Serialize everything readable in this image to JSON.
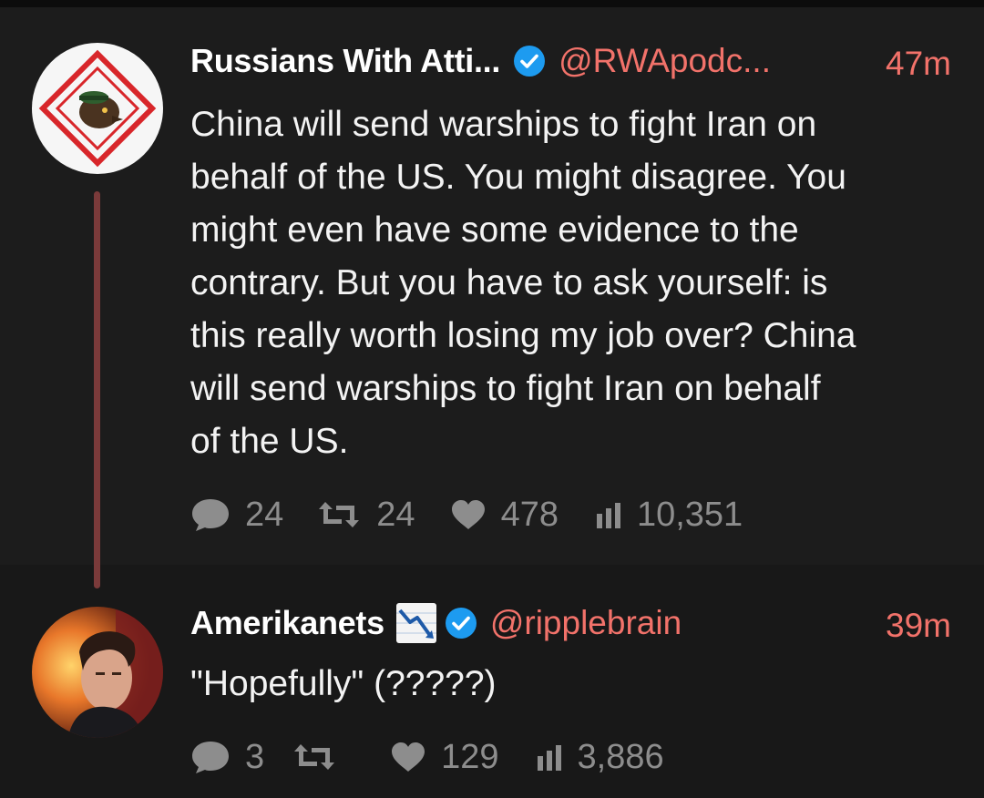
{
  "tweets": [
    {
      "name": "Russians With Atti...",
      "handle": "@RWApodc...",
      "time": "47m",
      "verified": true,
      "avatar_icon": "rwa-logo-avatar",
      "text": "China will send warships to fight Iran on\nbehalf of the US. You might disagree. You\nmight even have some evidence to the\ncontrary. But you have to ask yourself: is\nthis really worth losing my job over? China\nwill send warships to fight Iran on behalf\nof the US.",
      "replies": "24",
      "retweets": "24",
      "likes": "478",
      "views": "10,351"
    },
    {
      "name": "Amerikanets",
      "name_emoji": "chart-decreasing-icon",
      "handle": "@ripplebrain",
      "time": "39m",
      "verified": true,
      "avatar_icon": "user-photo-avatar",
      "text": "\"Hopefully\" (?????)",
      "replies": "3",
      "retweets": "",
      "likes": "129",
      "views": "3,886"
    }
  ],
  "colors": {
    "background": "#181818",
    "accent": "#f2726a",
    "verified": "#1d9bf0",
    "thread_line": "#7a3a3a",
    "muted": "#8d8d8d"
  }
}
